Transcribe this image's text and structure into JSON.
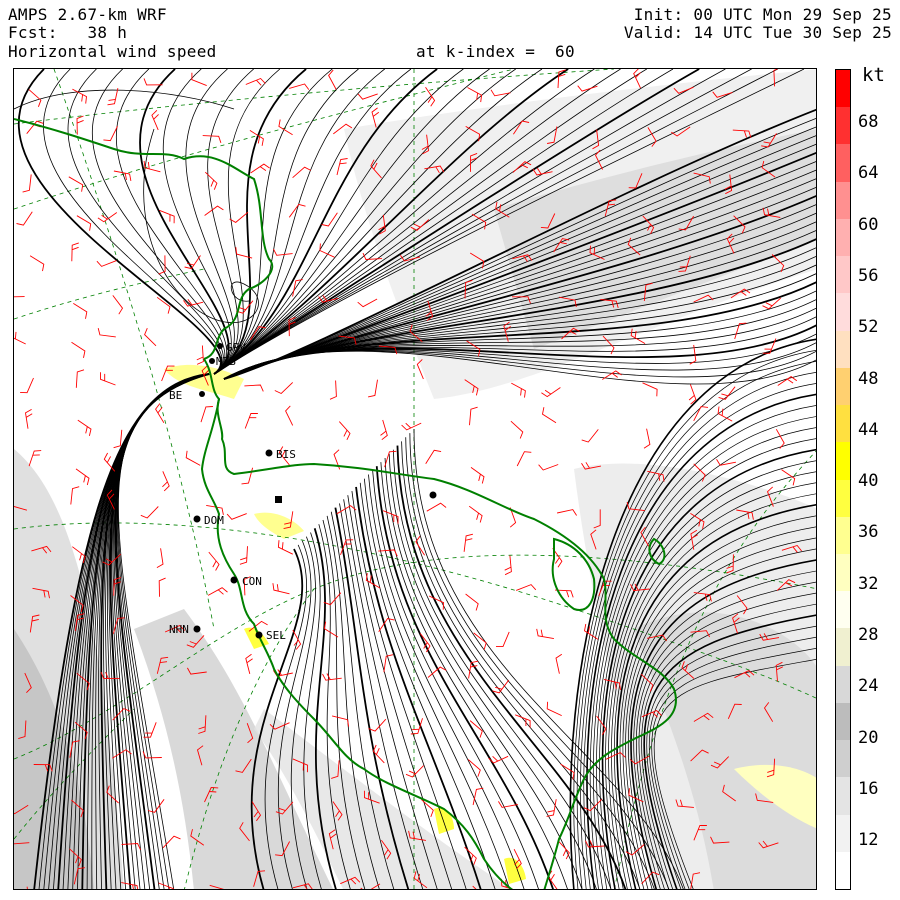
{
  "header": {
    "model": "AMPS 2.67-km WRF",
    "forecast": "Fcst:   38 h",
    "field": "Horizontal wind speed",
    "level": "at k-index =  60",
    "init": "Init: 00 UTC Mon 29 Sep 25",
    "valid": "Valid: 14 UTC Tue 30 Sep 25"
  },
  "colorbar": {
    "unit": "kt",
    "labels": [
      "68",
      "64",
      "60",
      "56",
      "52",
      "48",
      "44",
      "40",
      "36",
      "32",
      "28",
      "24",
      "20",
      "16",
      "12"
    ],
    "colors": [
      "#ff0000",
      "#ff3030",
      "#ff6060",
      "#ff9090",
      "#ffb0b0",
      "#ffc8c8",
      "#ffdcdc",
      "#ffe0c0",
      "#ffd070",
      "#ffe040",
      "#ffff00",
      "#ffff40",
      "#ffff90",
      "#ffffc0",
      "#fffff0",
      "#f0f0d0",
      "#d8d8d8",
      "#bcbcbc",
      "#cfcfcf",
      "#e4e4e4",
      "#f2f2f2",
      "#ffffff"
    ]
  },
  "map": {
    "stations": [
      {
        "name": "GPV"
      },
      {
        "name": "MZB"
      },
      {
        "name": "BE"
      },
      {
        "name": "BIS"
      },
      {
        "name": "DOM"
      },
      {
        "name": "CON"
      },
      {
        "name": "NHN"
      },
      {
        "name": "SEL"
      },
      {
        "name": ""
      },
      {
        "name": ""
      }
    ],
    "colors": {
      "coast": "#008000",
      "barbs": "#ff0000",
      "streamlines": "#000000",
      "grid": "#008000"
    }
  }
}
